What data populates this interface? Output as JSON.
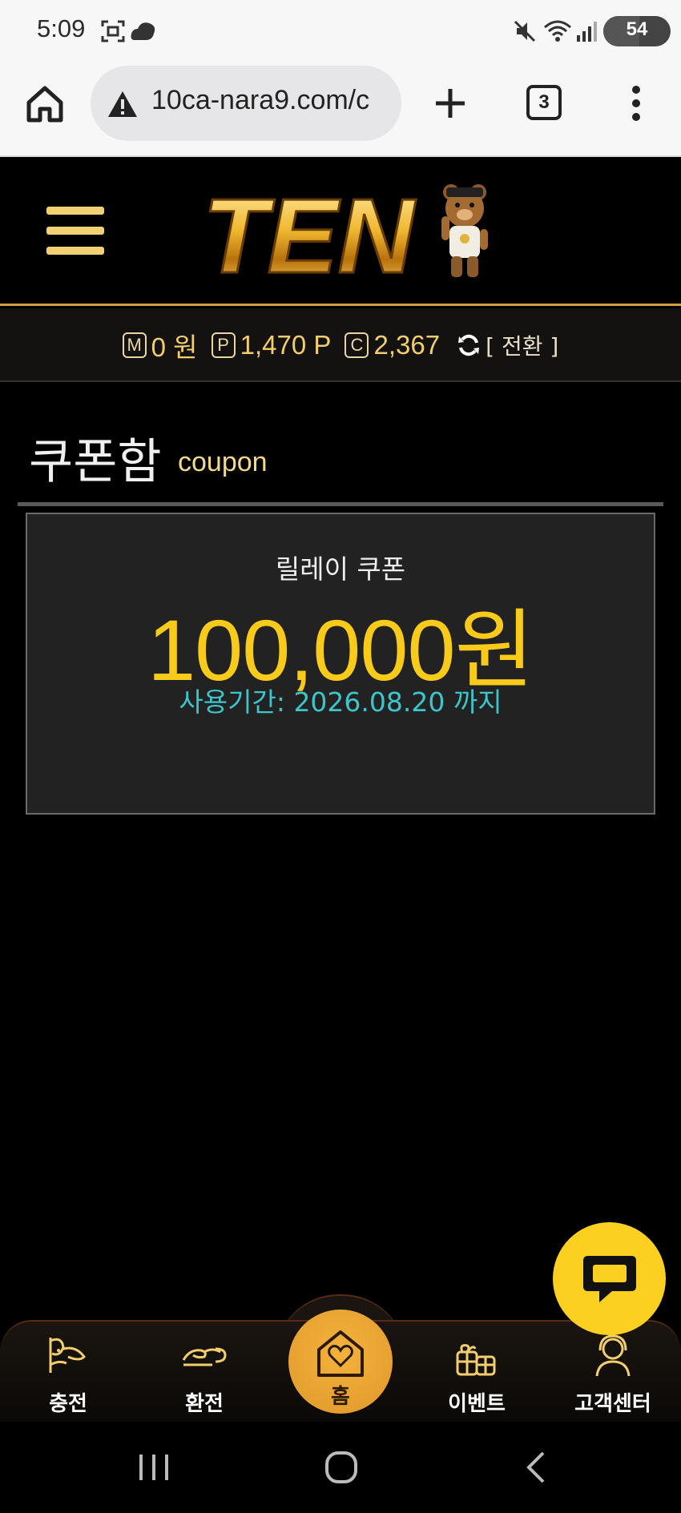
{
  "status_bar": {
    "time": "5:09",
    "battery": "54",
    "battery_level": 0.54,
    "icons": [
      "screenshot-icon",
      "cloud-icon",
      "mute-icon",
      "wifi-icon",
      "signal-icon",
      "battery-icon"
    ]
  },
  "browser": {
    "url": "10ca-nara9.com/c",
    "tab_count": "3",
    "icons": [
      "home-icon",
      "warning-icon",
      "plus-icon",
      "tabs-icon",
      "more-vert-icon"
    ]
  },
  "header": {
    "logo_text": "TEN",
    "menu_icon": "hamburger-icon"
  },
  "balance": {
    "money_badge": "M",
    "money": "0 원",
    "point_badge": "P",
    "point": "1,470 P",
    "casino_badge": "C",
    "casino": "2,367",
    "convert_label": "[ 전환 ]"
  },
  "page": {
    "title": "쿠폰함",
    "subtitle": "coupon"
  },
  "coupon": {
    "name": "릴레이 쿠폰",
    "amount": "100,000원",
    "period": "사용기간: 2026.08.20 까지"
  },
  "bottom_nav": {
    "items": [
      {
        "label": "충전",
        "icon": "deposit-icon"
      },
      {
        "label": "환전",
        "icon": "withdraw-icon"
      },
      {
        "label": "홈",
        "icon": "home-heart-icon"
      },
      {
        "label": "이벤트",
        "icon": "gift-icon"
      },
      {
        "label": "고객센터",
        "icon": "support-icon"
      }
    ]
  },
  "colors": {
    "accent_gold": "#f2cf6c",
    "coupon_amount": "#f8cb1b",
    "coupon_period": "#3cc6cc",
    "chat_fab": "#fcd020",
    "home_button": "#e8a532"
  }
}
